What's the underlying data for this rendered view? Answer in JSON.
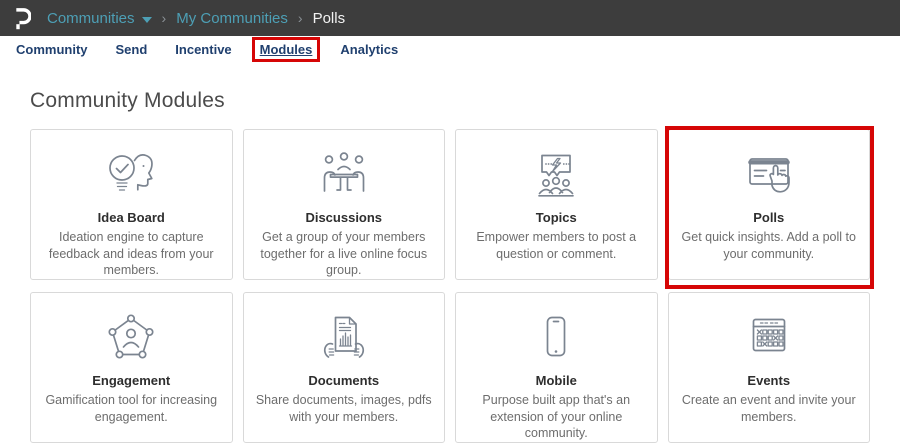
{
  "header": {
    "logo_name": "personify-logo",
    "separator": "›",
    "breadcrumb": [
      {
        "label": "Communities"
      },
      {
        "label": "My Communities"
      },
      {
        "label": "Polls"
      }
    ]
  },
  "tabs": [
    {
      "label": "Community"
    },
    {
      "label": "Send"
    },
    {
      "label": "Incentive"
    },
    {
      "label": "Modules",
      "active": true,
      "annotated": true
    },
    {
      "label": "Analytics"
    }
  ],
  "page_title": "Community Modules",
  "modules": [
    {
      "title": "Idea Board",
      "description": "Ideation engine to capture feedback and ideas from your members.",
      "icon": "idea-board-icon"
    },
    {
      "title": "Discussions",
      "description": "Get a group of your members together for a live online focus group.",
      "icon": "discussions-icon"
    },
    {
      "title": "Topics",
      "description": "Empower members to post a question or comment.",
      "icon": "topics-icon"
    },
    {
      "title": "Polls",
      "description": "Get quick insights. Add a poll to your community.",
      "icon": "polls-icon",
      "annotated": true
    },
    {
      "title": "Engagement",
      "description": "Gamification tool for increasing engagement.",
      "icon": "engagement-icon"
    },
    {
      "title": "Documents",
      "description": "Share documents, images, pdfs with your members.",
      "icon": "documents-icon"
    },
    {
      "title": "Mobile",
      "description": "Purpose built app that's an extension of your online community.",
      "icon": "mobile-icon"
    },
    {
      "title": "Events",
      "description": "Create an event and invite your members.",
      "icon": "events-icon"
    }
  ],
  "colors": {
    "header_bg": "#3d3d3d",
    "breadcrumb_link": "#4d9fb5",
    "breadcrumb_current": "#f2f2f2",
    "tab_text": "#20406f",
    "annotation_red": "#d60606",
    "card_border": "#d9d9d9",
    "icon_stroke": "#7b8490"
  }
}
